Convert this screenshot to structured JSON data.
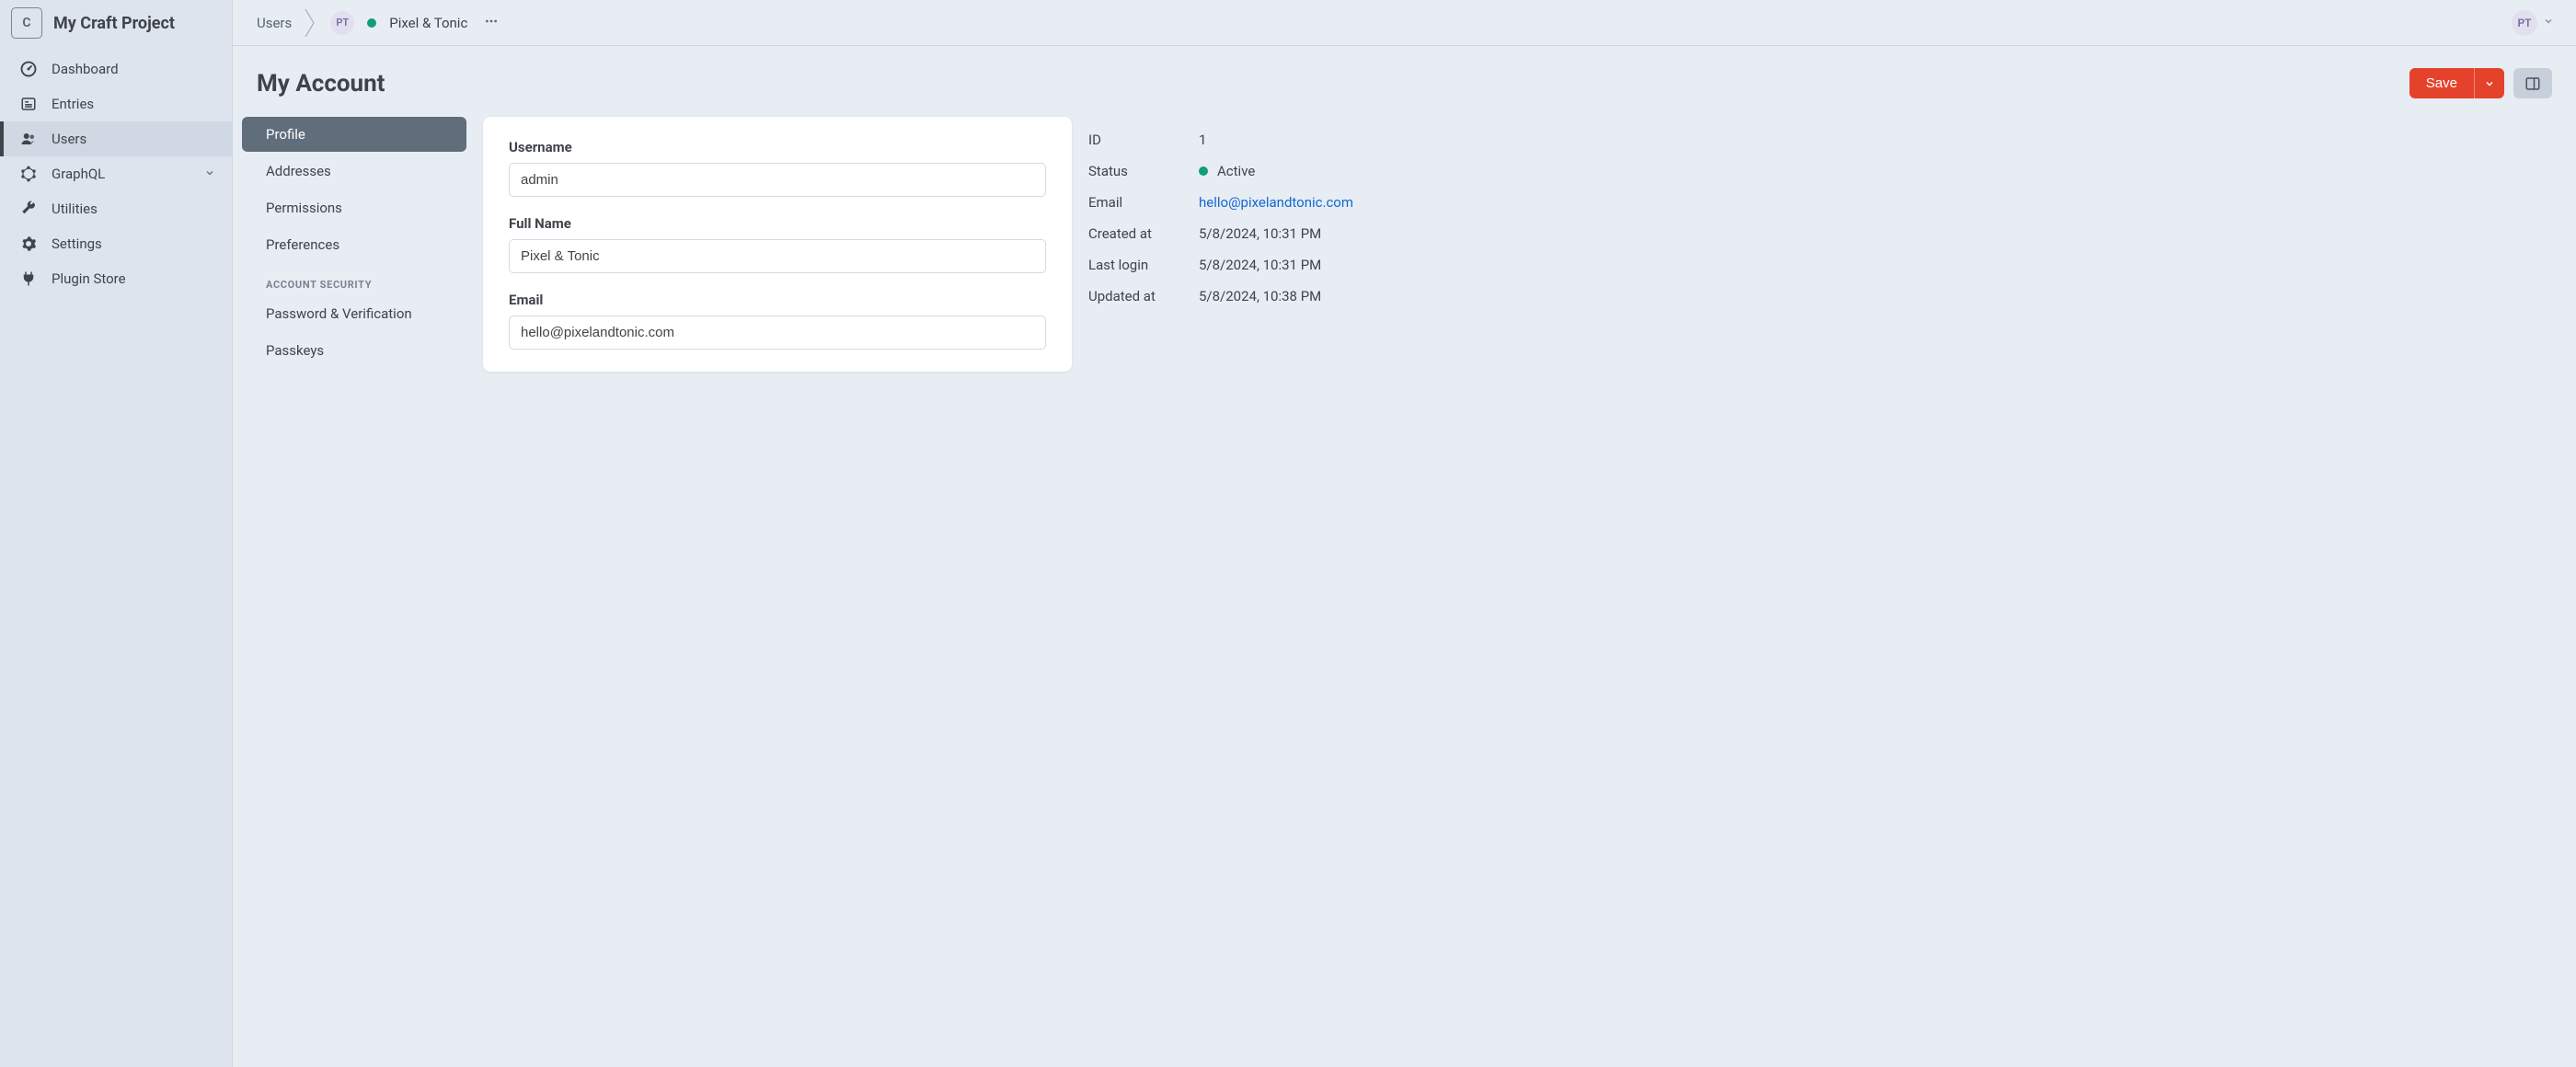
{
  "project_name": "My Craft Project",
  "logo_letter": "C",
  "nav": [
    {
      "label": "Dashboard",
      "icon": "gauge"
    },
    {
      "label": "Entries",
      "icon": "newspaper"
    },
    {
      "label": "Users",
      "icon": "users",
      "selected": true
    },
    {
      "label": "GraphQL",
      "icon": "graphql",
      "expandable": true
    },
    {
      "label": "Utilities",
      "icon": "wrench"
    },
    {
      "label": "Settings",
      "icon": "gear"
    },
    {
      "label": "Plugin Store",
      "icon": "plug"
    }
  ],
  "breadcrumb": {
    "root": "Users",
    "avatar_initials": "PT",
    "name": "Pixel & Tonic"
  },
  "user_menu": {
    "initials": "PT"
  },
  "page_title": "My Account",
  "save_label": "Save",
  "tabs": {
    "items": [
      "Profile",
      "Addresses",
      "Permissions",
      "Preferences"
    ],
    "security_heading": "ACCOUNT SECURITY",
    "security_items": [
      "Password & Verification",
      "Passkeys"
    ]
  },
  "fields": {
    "username": {
      "label": "Username",
      "value": "admin"
    },
    "fullname": {
      "label": "Full Name",
      "value": "Pixel & Tonic"
    },
    "email": {
      "label": "Email",
      "value": "hello@pixelandtonic.com"
    }
  },
  "meta": {
    "id": {
      "label": "ID",
      "value": "1"
    },
    "status": {
      "label": "Status",
      "value": "Active"
    },
    "email": {
      "label": "Email",
      "value": "hello@pixelandtonic.com"
    },
    "created": {
      "label": "Created at",
      "value": "5/8/2024, 10:31 PM"
    },
    "lastlogin": {
      "label": "Last login",
      "value": "5/8/2024, 10:31 PM"
    },
    "updated": {
      "label": "Updated at",
      "value": "5/8/2024, 10:38 PM"
    }
  }
}
